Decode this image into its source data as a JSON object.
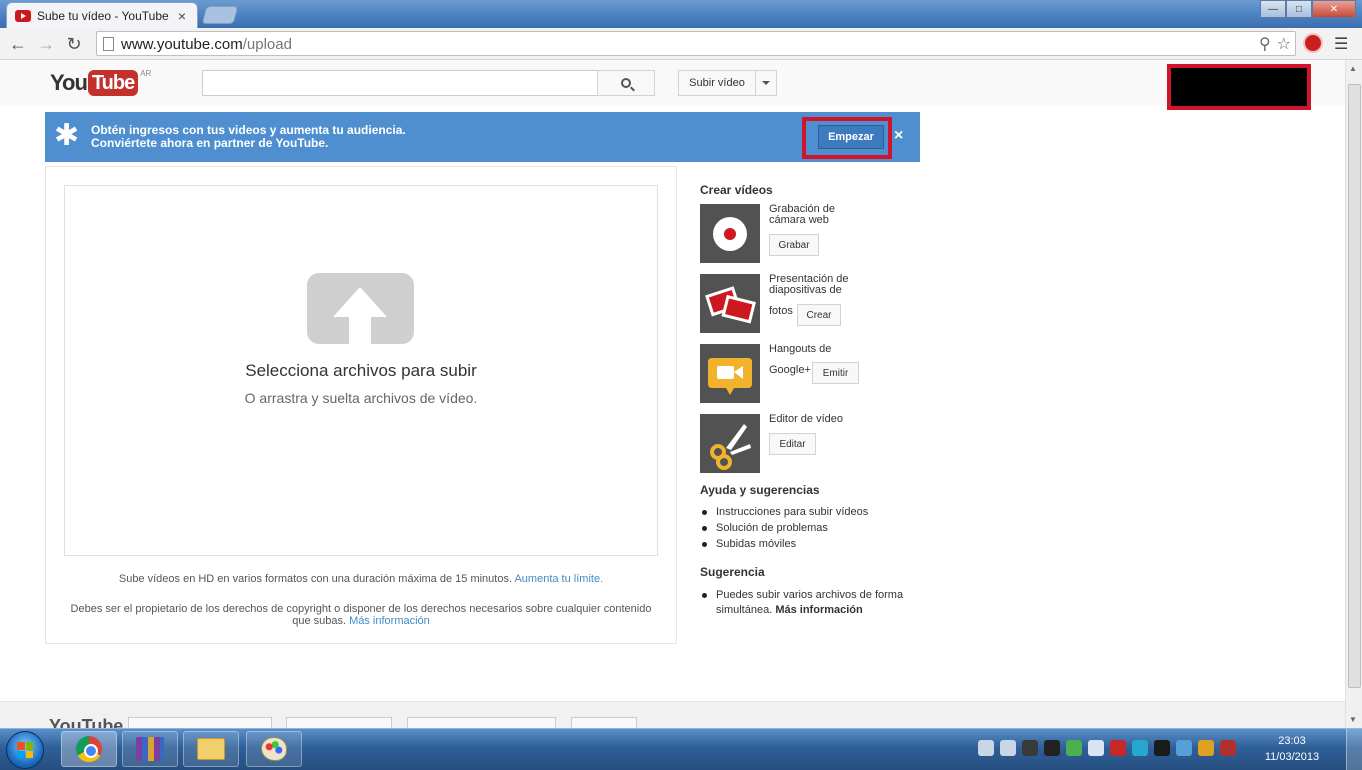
{
  "browser": {
    "tab_title": "Sube tu vídeo - YouTube",
    "tab_close": "×",
    "url_host": "www.youtube.com",
    "url_path": "/upload",
    "window_controls": {
      "minimize": "—",
      "maximize": "□",
      "close": "✕"
    }
  },
  "yt_header": {
    "logo_you": "You",
    "logo_tube": "Tube",
    "country": "AR",
    "search_placeholder": "",
    "upload_label": "Subir vídeo"
  },
  "banner": {
    "line1": "Obtén ingresos con tus videos y aumenta tu audiencia.",
    "line2": "Conviértete ahora en partner de YouTube.",
    "cta": "Empezar",
    "close": "×"
  },
  "upload": {
    "title": "Selecciona archivos para subir",
    "subtitle": "O arrastra y suelta archivos de vídeo.",
    "hd_note": "Sube vídeos en HD en varios formatos con una duración máxima de 15 minutos.",
    "hd_link": "Aumenta tu límite.",
    "copyright_text": "Debes ser el propietario de los derechos de copyright o disponer de los derechos necesarios sobre cualquier contenido que subas.",
    "copyright_link": "Más información"
  },
  "sidebar": {
    "create_heading": "Crear vídeos",
    "tools": [
      {
        "label_line1": "Grabación de",
        "label_line2": "cámara web",
        "button": "Grabar",
        "icon": "webcam-record-icon"
      },
      {
        "label_line1": "Presentación de",
        "label_line2": "diapositivas de",
        "label_line3": "fotos",
        "button": "Crear",
        "icon": "photo-slideshow-icon"
      },
      {
        "label_line1": "Hangouts de",
        "label_line2": "Google+",
        "button": "Emitir",
        "icon": "hangouts-camera-icon"
      },
      {
        "label_line1": "Editor de vídeo",
        "button": "Editar",
        "icon": "scissors-icon"
      }
    ],
    "help_heading": "Ayuda y sugerencias",
    "help_links": [
      "Instrucciones para subir vídeos",
      "Solución de problemas",
      "Subidas móviles"
    ],
    "tip_heading": "Sugerencia",
    "tip_text": "Puedes subir varios archivos de forma simultánea.",
    "tip_link": "Más información"
  },
  "footer": {
    "logo": "YouTube"
  },
  "taskbar": {
    "time": "23:03",
    "date": "11/03/2013"
  },
  "colors": {
    "banner_blue": "#4f8fd0",
    "youtube_red": "#c4302b",
    "highlight_red": "#d0142c",
    "link_blue": "#438bc5"
  }
}
